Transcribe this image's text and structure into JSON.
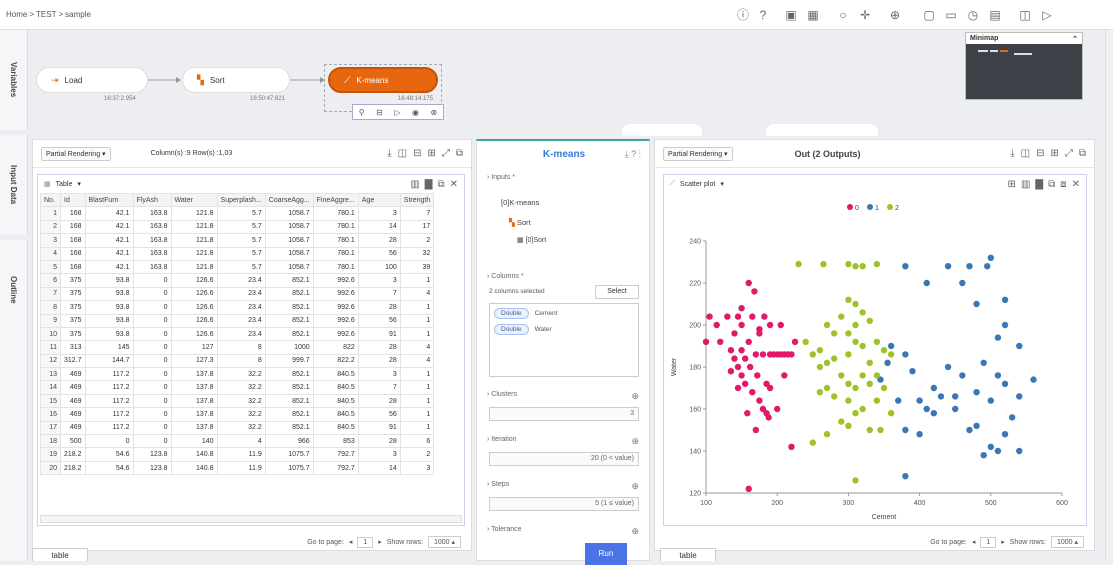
{
  "breadcrumb": [
    "Home",
    ">",
    "TEST",
    ">",
    "sample"
  ],
  "side_tabs": [
    "Variables",
    "Input Data",
    "Outline"
  ],
  "workflow": {
    "nodes": [
      {
        "label": "Load",
        "time": "16:37:2.954"
      },
      {
        "label": "Sort",
        "time": "16:50:47.621"
      },
      {
        "label": "K-means",
        "time": "16:48:14.175"
      }
    ],
    "minimap_label": "Minimap"
  },
  "left_panel": {
    "render_mode": "Partial Rendering",
    "counts": "Column(s) :9   Row(s) :1,03",
    "view_mode": "Table",
    "columns": [
      "No.",
      "Id",
      "BlastFurn",
      "FlyAsh",
      "Water",
      "Superplash...",
      "CoarseAgg...",
      "FineAggre...",
      "Age",
      "Strength"
    ],
    "rows": [
      [
        "1",
        "168",
        "42.1",
        "163.8",
        "121.8",
        "5.7",
        "1058.7",
        "780.1",
        "3",
        "7"
      ],
      [
        "2",
        "168",
        "42.1",
        "163.8",
        "121.8",
        "5.7",
        "1058.7",
        "780.1",
        "14",
        "17"
      ],
      [
        "3",
        "168",
        "42.1",
        "163.8",
        "121.8",
        "5.7",
        "1058.7",
        "780.1",
        "28",
        "2"
      ],
      [
        "4",
        "168",
        "42.1",
        "163.8",
        "121.8",
        "5.7",
        "1058.7",
        "780.1",
        "56",
        "32"
      ],
      [
        "5",
        "168",
        "42.1",
        "163.8",
        "121.8",
        "5.7",
        "1058.7",
        "780.1",
        "100",
        "39"
      ],
      [
        "6",
        "375",
        "93.8",
        "0",
        "126.6",
        "23.4",
        "852.1",
        "992.6",
        "3",
        "1"
      ],
      [
        "7",
        "375",
        "93.8",
        "0",
        "126.6",
        "23.4",
        "852.1",
        "992.6",
        "7",
        "4"
      ],
      [
        "8",
        "375",
        "93.8",
        "0",
        "126.6",
        "23.4",
        "852.1",
        "992.6",
        "28",
        "1"
      ],
      [
        "9",
        "375",
        "93.8",
        "0",
        "126.6",
        "23.4",
        "852.1",
        "992.6",
        "56",
        "1"
      ],
      [
        "10",
        "375",
        "93.8",
        "0",
        "126.6",
        "23.4",
        "852.1",
        "992.6",
        "91",
        "1"
      ],
      [
        "11",
        "313",
        "145",
        "0",
        "127",
        "8",
        "1000",
        "822",
        "28",
        "4"
      ],
      [
        "12",
        "312.7",
        "144.7",
        "0",
        "127.3",
        "8",
        "999.7",
        "822.2",
        "28",
        "4"
      ],
      [
        "13",
        "469",
        "117.2",
        "0",
        "137.8",
        "32.2",
        "852.1",
        "840.5",
        "3",
        "1"
      ],
      [
        "14",
        "469",
        "117.2",
        "0",
        "137.8",
        "32.2",
        "852.1",
        "840.5",
        "7",
        "1"
      ],
      [
        "15",
        "469",
        "117.2",
        "0",
        "137.8",
        "32.2",
        "852.1",
        "840.5",
        "28",
        "1"
      ],
      [
        "16",
        "469",
        "117.2",
        "0",
        "137.8",
        "32.2",
        "852.1",
        "840.5",
        "56",
        "1"
      ],
      [
        "17",
        "469",
        "117.2",
        "0",
        "137.8",
        "32.2",
        "852.1",
        "840.5",
        "91",
        "1"
      ],
      [
        "18",
        "500",
        "0",
        "0",
        "140",
        "4",
        "966",
        "853",
        "28",
        "6"
      ],
      [
        "19",
        "218.2",
        "54.6",
        "123.8",
        "140.8",
        "11.9",
        "1075.7",
        "792.7",
        "3",
        "2"
      ],
      [
        "20",
        "218.2",
        "54.6",
        "123.8",
        "140.8",
        "11.9",
        "1075.7",
        "792.7",
        "14",
        "3"
      ]
    ],
    "goto_label": "Go to page:",
    "page": "1",
    "show_rows_label": "Show rows:",
    "show_rows": "1000",
    "bottom_tab": "table"
  },
  "middle_panel": {
    "title": "K-means",
    "inputs_label": "Inputs",
    "input_item": "[0]K-means",
    "input_sub": "Sort",
    "input_sub2": "[0]Sort",
    "columns_label": "Columns",
    "columns_selected": "2 columns selected",
    "select_btn": "Select",
    "chips": [
      {
        "type": "Double",
        "name": "Cement"
      },
      {
        "type": "Double",
        "name": "Water"
      }
    ],
    "clusters_label": "Clusters",
    "clusters_value": "3",
    "iteration_label": "Iteration",
    "iteration_value": "20 (0 < value)",
    "steps_label": "Steps",
    "steps_value": "5 (1 ≤ value)",
    "tolerance_label": "Tolerance",
    "run_btn": "Run"
  },
  "right_panel": {
    "render_mode": "Partial Rendering",
    "title": "Out (2 Outputs)",
    "view_mode": "Scatter plot",
    "goto_label": "Go to page:",
    "page": "1",
    "show_rows_label": "Show rows:",
    "show_rows": "1000",
    "bottom_tab": "table"
  },
  "colors": {
    "c0": "#e0196a",
    "c1": "#3b77b5",
    "c2": "#9cc42a",
    "accent": "#e8670e",
    "run": "#4a73e8"
  },
  "chart_data": {
    "type": "scatter",
    "xlabel": "Cement",
    "ylabel": "Water",
    "xlim": [
      100,
      600
    ],
    "ylim": [
      120,
      240
    ],
    "xticks": [
      100,
      200,
      300,
      400,
      500,
      600
    ],
    "yticks": [
      120,
      140,
      160,
      180,
      200,
      220,
      240
    ],
    "legend": [
      "0",
      "1",
      "2"
    ],
    "series": [
      {
        "name": "0",
        "points": [
          [
            100,
            192
          ],
          [
            105,
            204
          ],
          [
            115,
            200
          ],
          [
            120,
            192
          ],
          [
            130,
            204
          ],
          [
            135,
            188
          ],
          [
            140,
            184
          ],
          [
            140,
            196
          ],
          [
            145,
            180
          ],
          [
            145,
            204
          ],
          [
            150,
            176
          ],
          [
            150,
            188
          ],
          [
            150,
            200
          ],
          [
            155,
            184
          ],
          [
            155,
            172
          ],
          [
            158,
            158
          ],
          [
            160,
            220
          ],
          [
            160,
            192
          ],
          [
            162,
            180
          ],
          [
            165,
            168
          ],
          [
            165,
            204
          ],
          [
            168,
            216
          ],
          [
            170,
            186
          ],
          [
            172,
            176
          ],
          [
            175,
            198
          ],
          [
            175,
            164
          ],
          [
            180,
            186
          ],
          [
            182,
            204
          ],
          [
            185,
            172
          ],
          [
            185,
            158
          ],
          [
            188,
            156
          ],
          [
            190,
            186
          ],
          [
            195,
            186
          ],
          [
            200,
            186
          ],
          [
            205,
            186
          ],
          [
            210,
            186
          ],
          [
            215,
            186
          ],
          [
            220,
            186
          ],
          [
            225,
            192
          ],
          [
            180,
            160
          ],
          [
            170,
            150
          ],
          [
            160,
            122
          ],
          [
            220,
            142
          ],
          [
            200,
            160
          ],
          [
            190,
            170
          ],
          [
            210,
            176
          ],
          [
            150,
            208
          ],
          [
            145,
            170
          ],
          [
            135,
            178
          ],
          [
            175,
            196
          ],
          [
            190,
            200
          ],
          [
            205,
            200
          ]
        ]
      },
      {
        "name": "1",
        "points": [
          [
            380,
            228
          ],
          [
            410,
            220
          ],
          [
            440,
            228
          ],
          [
            460,
            220
          ],
          [
            470,
            228
          ],
          [
            495,
            228
          ],
          [
            500,
            232
          ],
          [
            520,
            212
          ],
          [
            480,
            210
          ],
          [
            510,
            194
          ],
          [
            520,
            200
          ],
          [
            540,
            190
          ],
          [
            360,
            190
          ],
          [
            380,
            186
          ],
          [
            390,
            178
          ],
          [
            400,
            164
          ],
          [
            410,
            160
          ],
          [
            420,
            170
          ],
          [
            440,
            180
          ],
          [
            450,
            166
          ],
          [
            460,
            176
          ],
          [
            480,
            168
          ],
          [
            500,
            164
          ],
          [
            520,
            172
          ],
          [
            540,
            166
          ],
          [
            530,
            156
          ],
          [
            500,
            142
          ],
          [
            520,
            148
          ],
          [
            540,
            140
          ],
          [
            470,
            150
          ],
          [
            490,
            138
          ],
          [
            510,
            140
          ],
          [
            400,
            148
          ],
          [
            380,
            150
          ],
          [
            370,
            164
          ],
          [
            420,
            158
          ],
          [
            430,
            166
          ],
          [
            450,
            160
          ],
          [
            480,
            152
          ],
          [
            345,
            174
          ],
          [
            355,
            182
          ],
          [
            510,
            176
          ],
          [
            560,
            174
          ],
          [
            490,
            182
          ],
          [
            380,
            128
          ]
        ]
      },
      {
        "name": "2",
        "points": [
          [
            230,
            229
          ],
          [
            265,
            229
          ],
          [
            300,
            229
          ],
          [
            310,
            228
          ],
          [
            320,
            228
          ],
          [
            340,
            229
          ],
          [
            300,
            212
          ],
          [
            310,
            210
          ],
          [
            320,
            206
          ],
          [
            290,
            204
          ],
          [
            330,
            202
          ],
          [
            270,
            200
          ],
          [
            280,
            196
          ],
          [
            300,
            196
          ],
          [
            310,
            192
          ],
          [
            320,
            190
          ],
          [
            340,
            192
          ],
          [
            350,
            188
          ],
          [
            360,
            186
          ],
          [
            250,
            186
          ],
          [
            260,
            180
          ],
          [
            270,
            182
          ],
          [
            290,
            176
          ],
          [
            300,
            172
          ],
          [
            310,
            170
          ],
          [
            320,
            176
          ],
          [
            330,
            172
          ],
          [
            340,
            176
          ],
          [
            350,
            170
          ],
          [
            260,
            168
          ],
          [
            280,
            166
          ],
          [
            300,
            164
          ],
          [
            310,
            158
          ],
          [
            320,
            160
          ],
          [
            300,
            152
          ],
          [
            330,
            150
          ],
          [
            345,
            150
          ],
          [
            360,
            158
          ],
          [
            250,
            144
          ],
          [
            270,
            148
          ],
          [
            290,
            154
          ],
          [
            310,
            126
          ],
          [
            260,
            188
          ],
          [
            240,
            192
          ],
          [
            310,
            200
          ],
          [
            330,
            182
          ],
          [
            280,
            184
          ],
          [
            300,
            186
          ],
          [
            270,
            170
          ],
          [
            340,
            164
          ]
        ]
      }
    ]
  }
}
